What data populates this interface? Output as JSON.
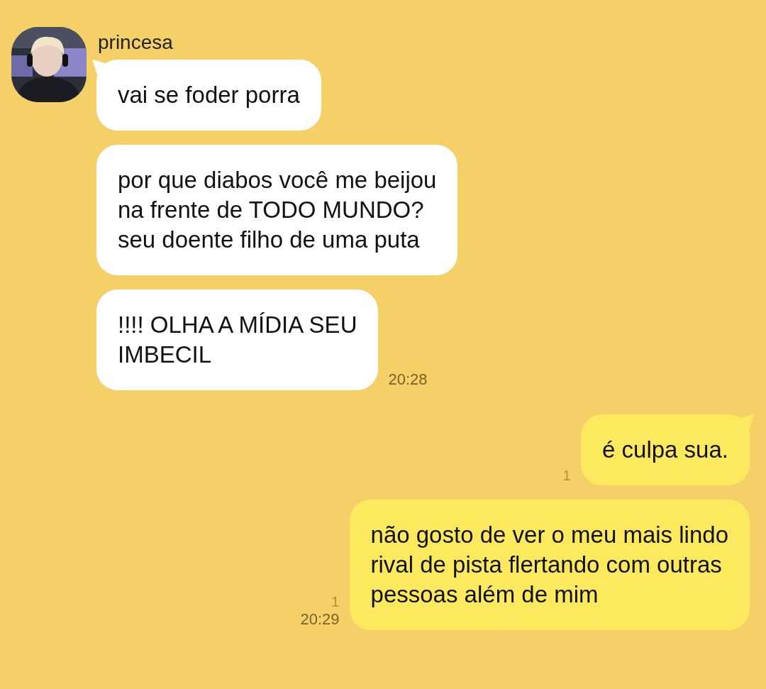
{
  "groups": [
    {
      "kind": "received",
      "sender": "princesa",
      "messages": [
        {
          "text": "vai se foder porra",
          "tail": true
        },
        {
          "text": "por que diabos você me beijou\nna frente de TODO MUNDO?\nseu doente filho de uma puta",
          "tail": false
        },
        {
          "text": "!!!! OLHA A MÍDIA SEU\nIMBECIL",
          "tail": false,
          "time": "20:28"
        }
      ]
    },
    {
      "kind": "sent",
      "messages": [
        {
          "text": "é culpa sua.",
          "tail": true,
          "unread": "1"
        },
        {
          "text": "não gosto de ver o meu mais lindo\nrival de pista flertando com outras\npessoas além de mim",
          "tail": false,
          "unread": "1",
          "time": "20:29"
        }
      ]
    }
  ]
}
